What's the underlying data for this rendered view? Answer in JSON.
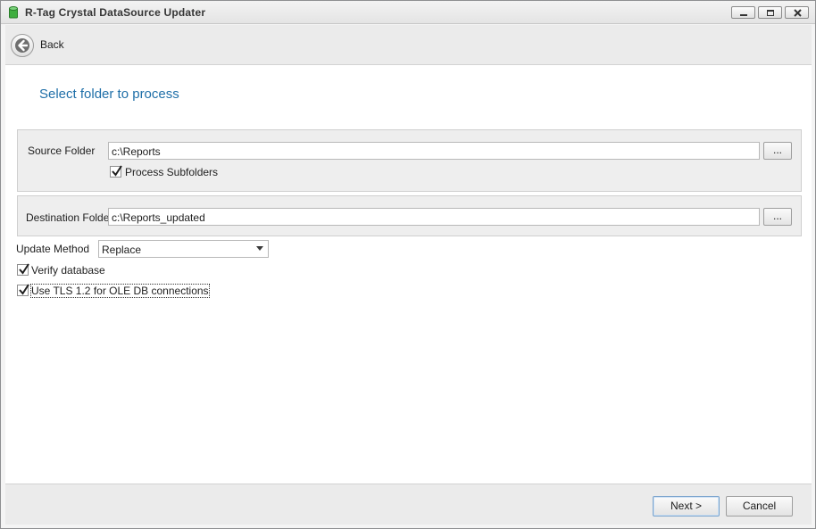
{
  "window": {
    "title": "R-Tag Crystal DataSource Updater",
    "icon": "database-icon",
    "controls": [
      "minimize-icon",
      "maximize-icon",
      "close-icon"
    ]
  },
  "nav": {
    "back_label": "Back"
  },
  "page": {
    "heading": "Select folder to process"
  },
  "source": {
    "label": "Source Folder",
    "value": "c:\\Reports",
    "browse_label": "...",
    "subfolders_label": "Process Subfolders",
    "subfolders_checked": true
  },
  "destination": {
    "label": "Destination Folder",
    "value": "c:\\Reports_updated",
    "browse_label": "..."
  },
  "update_method": {
    "label": "Update Method",
    "selected": "Replace"
  },
  "options": {
    "verify_label": "Verify database",
    "verify_checked": true,
    "tls_label": "Use TLS 1.2 for OLE DB connections",
    "tls_checked": true
  },
  "footer": {
    "next_label": "Next >",
    "cancel_label": "Cancel"
  },
  "colors": {
    "heading": "#1f6fa8",
    "panel": "#eeeeee",
    "chrome": "#ebebeb"
  }
}
